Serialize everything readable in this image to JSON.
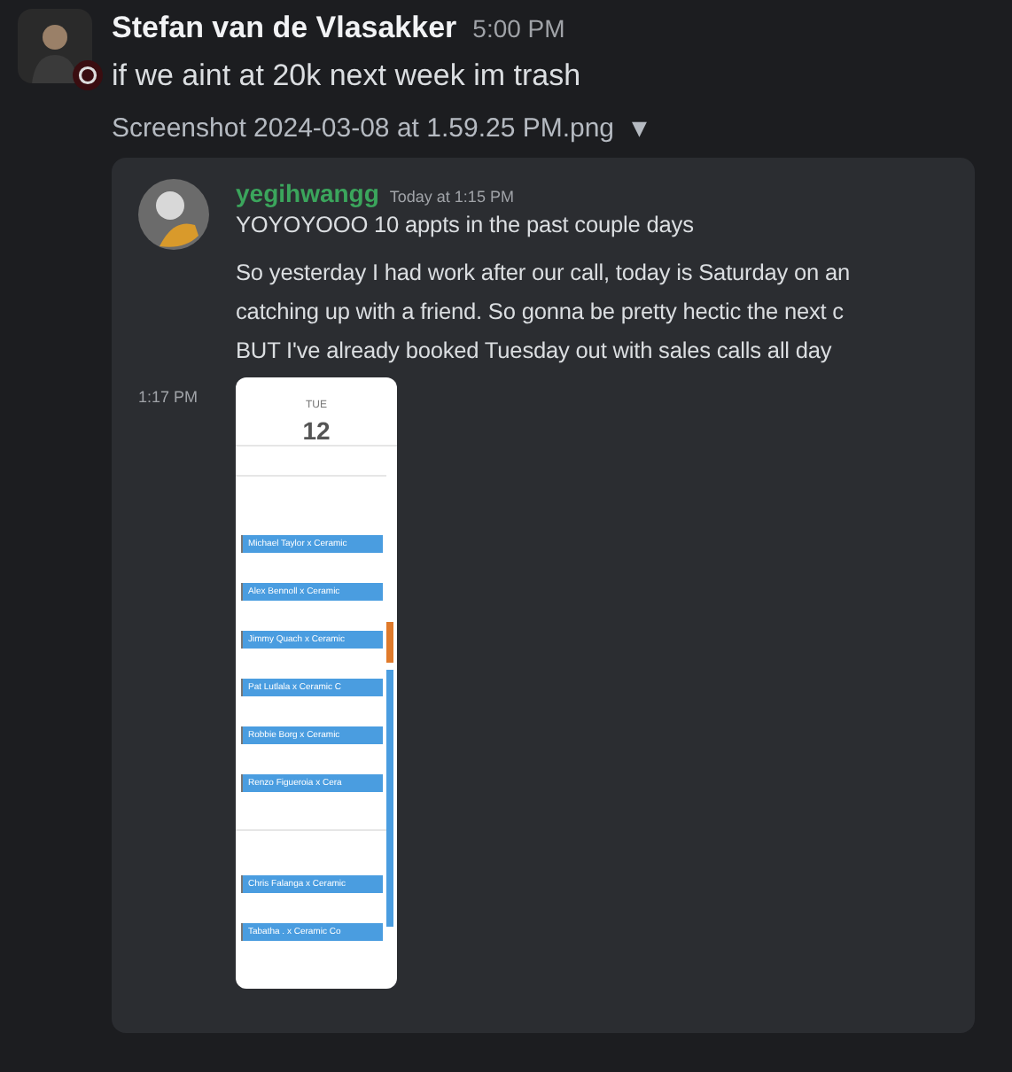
{
  "message": {
    "author": "Stefan van de Vlasakker",
    "time": "5:00 PM",
    "text": "if we aint at 20k next week im trash",
    "attachment": "Screenshot 2024-03-08 at 1.59.25 PM.png",
    "caret": "▼"
  },
  "embed": {
    "author": "yegihwangg",
    "time": "Today at 1:15 PM",
    "lines": [
      "YOYOYOOO 10 appts in the past couple days",
      "So yesterday I had work after our call, today is Saturday on an",
      "catching up with a friend. So gonna be pretty hectic the next c",
      "BUT I've already booked Tuesday out with sales calls all day"
    ],
    "reply_time": "1:17 PM",
    "calendar": {
      "day": "TUE",
      "date": "12",
      "groups": [
        {
          "events": [
            "Michael Taylor x Ceramic",
            "Alex Bennoll x Ceramic",
            "Jimmy Quach x Ceramic",
            "Pat Lutlala x Ceramic C",
            "Robbie Borg x Ceramic",
            "Renzo Figueroia x Cera"
          ]
        },
        {
          "events": [
            "Chris Falanga x Ceramic",
            "Tabatha . x Ceramic Co"
          ]
        }
      ]
    }
  }
}
